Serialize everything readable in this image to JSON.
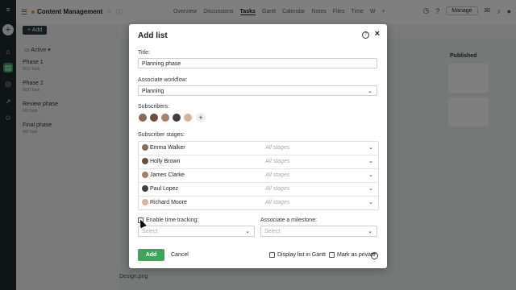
{
  "app": {
    "project_title": "Content Management",
    "tabs": [
      "Overview",
      "Discussions",
      "Tasks",
      "Gantt",
      "Calendar",
      "Notes",
      "Files",
      "Time",
      "W"
    ],
    "active_tab": "Tasks",
    "manage_label": "Manage",
    "add_label": "Add",
    "filter_label": "Active",
    "phases": [
      {
        "name": "Phase 1",
        "meta": "2/10 Task"
      },
      {
        "name": "Phase 2",
        "meta": "0/10 Task"
      },
      {
        "name": "Review phase",
        "meta": "0/3 Task"
      },
      {
        "name": "Final phase",
        "meta": "4/8 Task"
      }
    ],
    "published_title": "Published",
    "bottom_file": "Design.png",
    "colors": {
      "accent": "#3aa55b",
      "rail": "#1f2a2e"
    }
  },
  "modal": {
    "title": "Add list",
    "title_label": "Title:",
    "title_value": "Planning phase",
    "workflow_label": "Associate workflow:",
    "workflow_value": "Planning",
    "subscribers_label": "Subscribers:",
    "stages_label": "Subscriber stages:",
    "stages": [
      {
        "name": "Emma Walker",
        "value": "All stages"
      },
      {
        "name": "Holly Brown",
        "value": "All stages"
      },
      {
        "name": "James Clarke",
        "value": "All stages"
      },
      {
        "name": "Paul Lopez",
        "value": "All stages"
      },
      {
        "name": "Richard Moore",
        "value": "All stages"
      }
    ],
    "time_tracking_label": "Enable time tracking:",
    "time_tracking_placeholder": "Select",
    "milestone_label": "Associate a milestone:",
    "milestone_placeholder": "Select",
    "add_button": "Add",
    "cancel_button": "Cancel",
    "gantt_label": "Display list in Gantt",
    "private_label": "Mark as private"
  }
}
